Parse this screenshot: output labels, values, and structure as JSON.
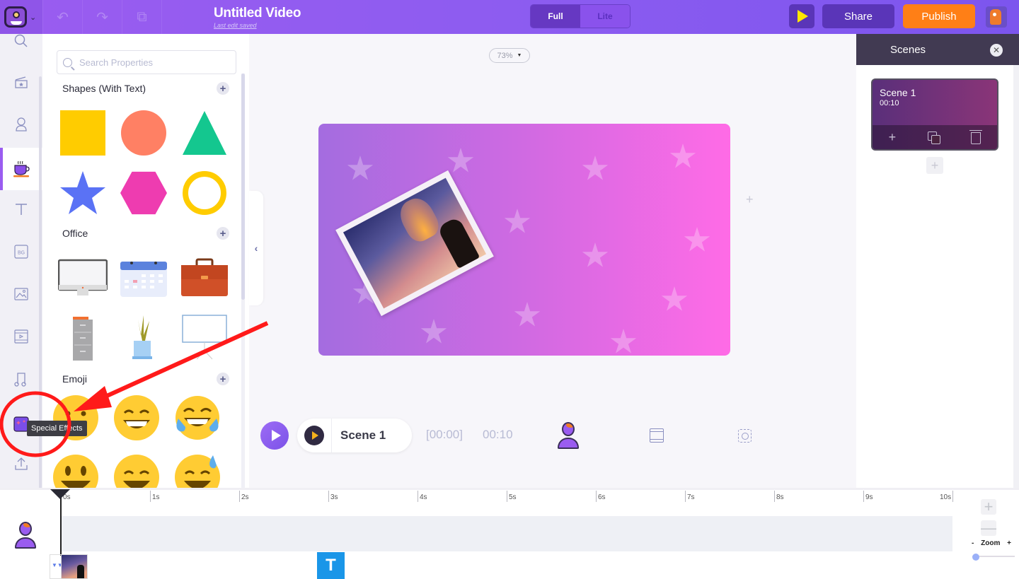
{
  "app": {
    "title": "Untitled Video",
    "save_status": "Last edit saved"
  },
  "toolbar": {
    "undo_icon": "undo-icon",
    "redo_icon": "redo-icon",
    "duplicate_icon": "duplicate-icon",
    "mode_options": [
      "Full",
      "Lite"
    ],
    "mode_selected": "Full",
    "preview_icon": "play-icon",
    "share_label": "Share",
    "publish_label": "Publish",
    "avatar_icon": "fox-avatar"
  },
  "rail": {
    "items": [
      {
        "name": "search",
        "icon": "search-icon"
      },
      {
        "name": "scenes",
        "icon": "clapperboard-icon"
      },
      {
        "name": "characters",
        "icon": "character-icon"
      },
      {
        "name": "properties",
        "icon": "coffee-cup-icon",
        "active": true
      },
      {
        "name": "text",
        "icon": "text-icon"
      },
      {
        "name": "background",
        "icon": "bg-icon",
        "glyph": "BG"
      },
      {
        "name": "images",
        "icon": "image-icon"
      },
      {
        "name": "videos",
        "icon": "video-icon"
      },
      {
        "name": "music",
        "icon": "music-icon"
      },
      {
        "name": "special-effects",
        "icon": "special-effects-icon"
      },
      {
        "name": "upload",
        "icon": "upload-icon"
      }
    ],
    "tooltip": "Special Effects"
  },
  "properties": {
    "search_placeholder": "Search Properties",
    "sections": [
      {
        "title": "Shapes (With Text)",
        "items": [
          {
            "name": "square",
            "color": "#ffcc00"
          },
          {
            "name": "circle",
            "color": "#ff8064"
          },
          {
            "name": "triangle",
            "color": "#14c78f"
          },
          {
            "name": "star",
            "color": "#5a72f5"
          },
          {
            "name": "hexagon",
            "color": "#ee3cb0"
          },
          {
            "name": "ring",
            "color": "#ffcc00"
          }
        ]
      },
      {
        "title": "Office",
        "items": [
          {
            "name": "monitor"
          },
          {
            "name": "calendar"
          },
          {
            "name": "briefcase"
          },
          {
            "name": "file-cabinet"
          },
          {
            "name": "plant"
          },
          {
            "name": "projector-screen"
          }
        ]
      },
      {
        "title": "Emoji",
        "items": [
          {
            "name": "emoji-neutral"
          },
          {
            "name": "emoji-grin"
          },
          {
            "name": "emoji-tears-of-joy"
          },
          {
            "name": "emoji-smiley"
          },
          {
            "name": "emoji-beaming"
          },
          {
            "name": "emoji-sweat-smile"
          }
        ]
      }
    ]
  },
  "canvas": {
    "zoom_level": "73%",
    "background_gradient": [
      "#a46ce0",
      "#ff6be6"
    ],
    "image": "sky-lantern-photo"
  },
  "player": {
    "scene_label": "Scene 1",
    "current_time": "[00:00]",
    "total_time": "00:10"
  },
  "scenes_panel": {
    "title": "Scenes",
    "scenes": [
      {
        "name": "Scene 1",
        "duration": "00:10"
      }
    ]
  },
  "timeline": {
    "ticks": [
      "0s",
      "1s",
      "2s",
      "3s",
      "4s",
      "5s",
      "6s",
      "7s",
      "8s",
      "9s",
      "10s"
    ],
    "text_clip_glyph": "T",
    "zoom_label": "Zoom",
    "zoom_minus": "-",
    "zoom_plus": "+",
    "zoom_level": 0
  },
  "colors": {
    "accent": "#9a5cf0",
    "publish": "#ff7f16",
    "share": "#5a35b8",
    "annotation": "#ff1a1a"
  }
}
